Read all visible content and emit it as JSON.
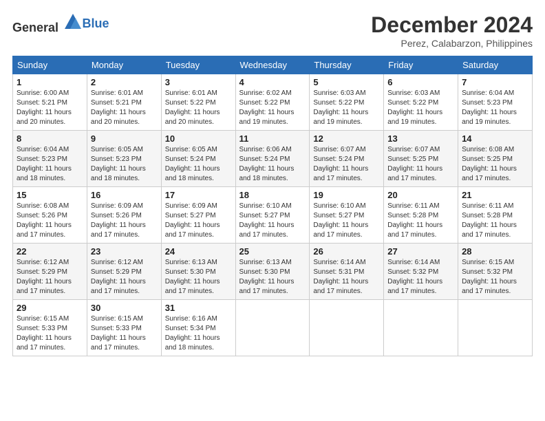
{
  "header": {
    "logo_general": "General",
    "logo_blue": "Blue",
    "month_title": "December 2024",
    "location": "Perez, Calabarzon, Philippines"
  },
  "weekdays": [
    "Sunday",
    "Monday",
    "Tuesday",
    "Wednesday",
    "Thursday",
    "Friday",
    "Saturday"
  ],
  "weeks": [
    [
      {
        "day": "1",
        "sunrise": "6:00 AM",
        "sunset": "5:21 PM",
        "daylight": "11 hours and 20 minutes."
      },
      {
        "day": "2",
        "sunrise": "6:01 AM",
        "sunset": "5:21 PM",
        "daylight": "11 hours and 20 minutes."
      },
      {
        "day": "3",
        "sunrise": "6:01 AM",
        "sunset": "5:22 PM",
        "daylight": "11 hours and 20 minutes."
      },
      {
        "day": "4",
        "sunrise": "6:02 AM",
        "sunset": "5:22 PM",
        "daylight": "11 hours and 19 minutes."
      },
      {
        "day": "5",
        "sunrise": "6:03 AM",
        "sunset": "5:22 PM",
        "daylight": "11 hours and 19 minutes."
      },
      {
        "day": "6",
        "sunrise": "6:03 AM",
        "sunset": "5:22 PM",
        "daylight": "11 hours and 19 minutes."
      },
      {
        "day": "7",
        "sunrise": "6:04 AM",
        "sunset": "5:23 PM",
        "daylight": "11 hours and 19 minutes."
      }
    ],
    [
      {
        "day": "8",
        "sunrise": "6:04 AM",
        "sunset": "5:23 PM",
        "daylight": "11 hours and 18 minutes."
      },
      {
        "day": "9",
        "sunrise": "6:05 AM",
        "sunset": "5:23 PM",
        "daylight": "11 hours and 18 minutes."
      },
      {
        "day": "10",
        "sunrise": "6:05 AM",
        "sunset": "5:24 PM",
        "daylight": "11 hours and 18 minutes."
      },
      {
        "day": "11",
        "sunrise": "6:06 AM",
        "sunset": "5:24 PM",
        "daylight": "11 hours and 18 minutes."
      },
      {
        "day": "12",
        "sunrise": "6:07 AM",
        "sunset": "5:24 PM",
        "daylight": "11 hours and 17 minutes."
      },
      {
        "day": "13",
        "sunrise": "6:07 AM",
        "sunset": "5:25 PM",
        "daylight": "11 hours and 17 minutes."
      },
      {
        "day": "14",
        "sunrise": "6:08 AM",
        "sunset": "5:25 PM",
        "daylight": "11 hours and 17 minutes."
      }
    ],
    [
      {
        "day": "15",
        "sunrise": "6:08 AM",
        "sunset": "5:26 PM",
        "daylight": "11 hours and 17 minutes."
      },
      {
        "day": "16",
        "sunrise": "6:09 AM",
        "sunset": "5:26 PM",
        "daylight": "11 hours and 17 minutes."
      },
      {
        "day": "17",
        "sunrise": "6:09 AM",
        "sunset": "5:27 PM",
        "daylight": "11 hours and 17 minutes."
      },
      {
        "day": "18",
        "sunrise": "6:10 AM",
        "sunset": "5:27 PM",
        "daylight": "11 hours and 17 minutes."
      },
      {
        "day": "19",
        "sunrise": "6:10 AM",
        "sunset": "5:27 PM",
        "daylight": "11 hours and 17 minutes."
      },
      {
        "day": "20",
        "sunrise": "6:11 AM",
        "sunset": "5:28 PM",
        "daylight": "11 hours and 17 minutes."
      },
      {
        "day": "21",
        "sunrise": "6:11 AM",
        "sunset": "5:28 PM",
        "daylight": "11 hours and 17 minutes."
      }
    ],
    [
      {
        "day": "22",
        "sunrise": "6:12 AM",
        "sunset": "5:29 PM",
        "daylight": "11 hours and 17 minutes."
      },
      {
        "day": "23",
        "sunrise": "6:12 AM",
        "sunset": "5:29 PM",
        "daylight": "11 hours and 17 minutes."
      },
      {
        "day": "24",
        "sunrise": "6:13 AM",
        "sunset": "5:30 PM",
        "daylight": "11 hours and 17 minutes."
      },
      {
        "day": "25",
        "sunrise": "6:13 AM",
        "sunset": "5:30 PM",
        "daylight": "11 hours and 17 minutes."
      },
      {
        "day": "26",
        "sunrise": "6:14 AM",
        "sunset": "5:31 PM",
        "daylight": "11 hours and 17 minutes."
      },
      {
        "day": "27",
        "sunrise": "6:14 AM",
        "sunset": "5:32 PM",
        "daylight": "11 hours and 17 minutes."
      },
      {
        "day": "28",
        "sunrise": "6:15 AM",
        "sunset": "5:32 PM",
        "daylight": "11 hours and 17 minutes."
      }
    ],
    [
      {
        "day": "29",
        "sunrise": "6:15 AM",
        "sunset": "5:33 PM",
        "daylight": "11 hours and 17 minutes."
      },
      {
        "day": "30",
        "sunrise": "6:15 AM",
        "sunset": "5:33 PM",
        "daylight": "11 hours and 17 minutes."
      },
      {
        "day": "31",
        "sunrise": "6:16 AM",
        "sunset": "5:34 PM",
        "daylight": "11 hours and 18 minutes."
      },
      null,
      null,
      null,
      null
    ]
  ]
}
